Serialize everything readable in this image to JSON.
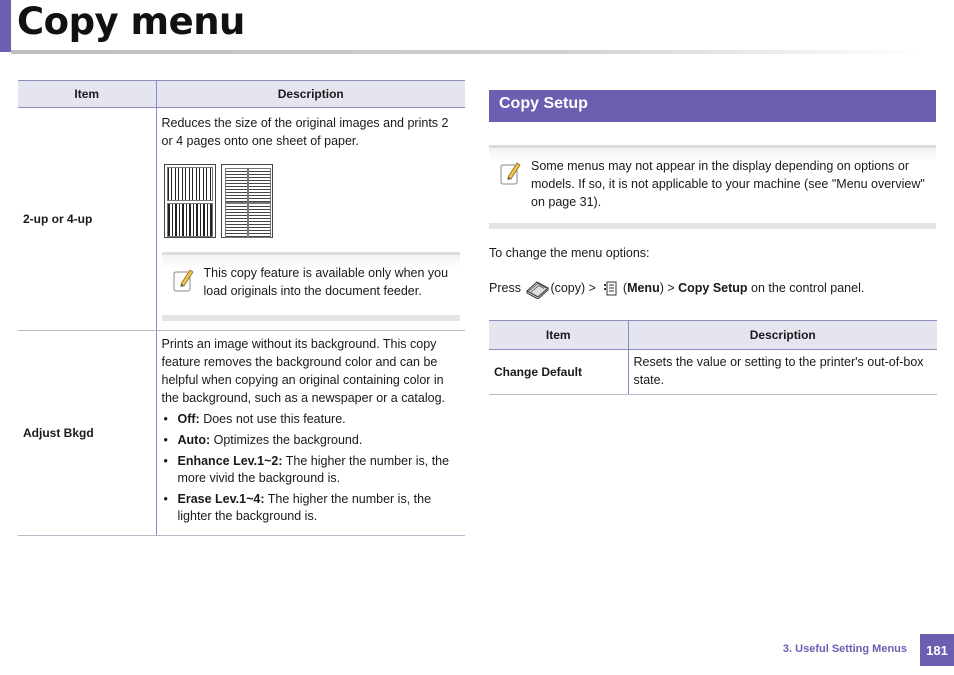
{
  "page": {
    "title": "Copy menu",
    "footer_chapter": "3.  Useful Setting Menus",
    "page_number": "181"
  },
  "left_table": {
    "headers": {
      "item": "Item",
      "description": "Description"
    },
    "rows": [
      {
        "item": "2-up or 4-up",
        "description": "Reduces the size of the original images and prints 2 or 4 pages onto one sheet of paper.",
        "note": "This copy feature is available only when you load originals into the document feeder."
      },
      {
        "item": "Adjust Bkgd",
        "description": "Prints an image without its background. This copy feature removes the background color and can be helpful when copying an original containing color in the background, such as a newspaper or a catalog.",
        "bullets": [
          {
            "term": "Off:",
            "text": " Does not use this feature."
          },
          {
            "term": "Auto:",
            "text": " Optimizes the background."
          },
          {
            "term": "Enhance Lev.1~2:",
            "text": " The higher the number is, the more vivid the background is."
          },
          {
            "term": "Erase Lev.1~4:",
            "text": " The higher the number is, the lighter the background is."
          }
        ]
      }
    ]
  },
  "section": {
    "heading": "Copy Setup",
    "note": "Some menus may not appear in the display depending on options or models. If so, it is not applicable to your machine (see \"Menu overview\" on page 31).",
    "intro": "To change the menu options:",
    "instruction": {
      "press": "Press ",
      "copy_label": "(copy) > ",
      "open_paren": " (",
      "menu_label": "Menu",
      "close_paren": ") > ",
      "copy_setup_label": "Copy Setup",
      "tail": " on the control panel."
    }
  },
  "right_table": {
    "headers": {
      "item": "Item",
      "description": "Description"
    },
    "rows": [
      {
        "item": "Change Default",
        "description": "Resets the value or setting to the printer's out-of-box state."
      }
    ]
  },
  "colors": {
    "accent": "#6c5fb2",
    "header_fill": "#e5e5f0"
  },
  "icons": [
    "note-pencil-icon",
    "copy-button-icon",
    "menu-button-icon",
    "two-up-thumbnail-icon",
    "four-up-thumbnail-icon"
  ]
}
